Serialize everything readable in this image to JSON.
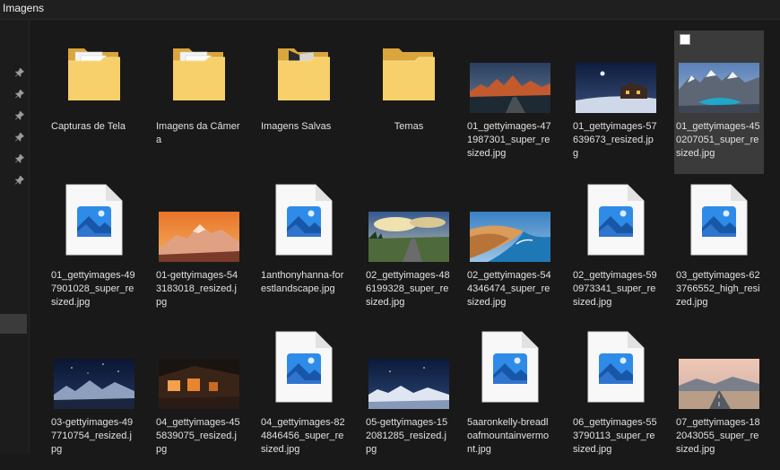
{
  "window": {
    "title": "Imagens"
  },
  "items": [
    {
      "kind": "folder",
      "variant": "doc",
      "name": "Capturas de Tela",
      "align": "left"
    },
    {
      "kind": "folder",
      "variant": "doc",
      "name": "Imagens da Câmera",
      "align": "left"
    },
    {
      "kind": "folder",
      "variant": "dark",
      "name": "Imagens Salvas",
      "align": "left"
    },
    {
      "kind": "folder",
      "variant": "plain",
      "name": "Temas",
      "align": "center"
    },
    {
      "kind": "photo",
      "scene": "patagonia",
      "name": "01_gettyimages-471987301_super_resized.jpg"
    },
    {
      "kind": "photo",
      "scene": "cabin-night",
      "name": "01_gettyimages-57639673_resized.jpg"
    },
    {
      "kind": "photo",
      "scene": "alpine-lake",
      "name": "01_gettyimages-450207051_super_resized.jpg",
      "selected": true
    },
    {
      "kind": "file",
      "name": "01_gettyimages-497901028_super_resized.jpg"
    },
    {
      "kind": "photo",
      "scene": "sunset-peak",
      "name": "01-gettyimages-543183018_resized.jpg"
    },
    {
      "kind": "file",
      "name": "1anthonyhanna-forestlandscape.jpg"
    },
    {
      "kind": "photo",
      "scene": "road-clouds",
      "name": "02_gettyimages-486199328_super_resized.jpg"
    },
    {
      "kind": "photo",
      "scene": "desert-coast",
      "name": "02_gettyimages-544346474_super_resized.jpg"
    },
    {
      "kind": "file",
      "name": "02_gettyimages-590973341_super_resized.jpg"
    },
    {
      "kind": "file",
      "name": "03_gettyimages-623766552_high_resized.jpg"
    },
    {
      "kind": "photo",
      "scene": "night-mountains",
      "name": "03-gettyimages-497710754_resized.jpg"
    },
    {
      "kind": "photo",
      "scene": "lodge-night",
      "name": "04_gettyimages-455839075_resized.jpg"
    },
    {
      "kind": "file",
      "name": "04_gettyimages-824846456_super_resized.jpg"
    },
    {
      "kind": "photo",
      "scene": "snow-night",
      "name": "05-gettyimages-152081285_resized.jpg"
    },
    {
      "kind": "file",
      "name": "5aaronkelly-breadloafmountainvermont.jpg"
    },
    {
      "kind": "file",
      "name": "06_gettyimages-553790113_super_resized.jpg"
    },
    {
      "kind": "photo",
      "scene": "desert-road",
      "name": "07_gettyimages-182043055_super_resized.jpg"
    }
  ]
}
